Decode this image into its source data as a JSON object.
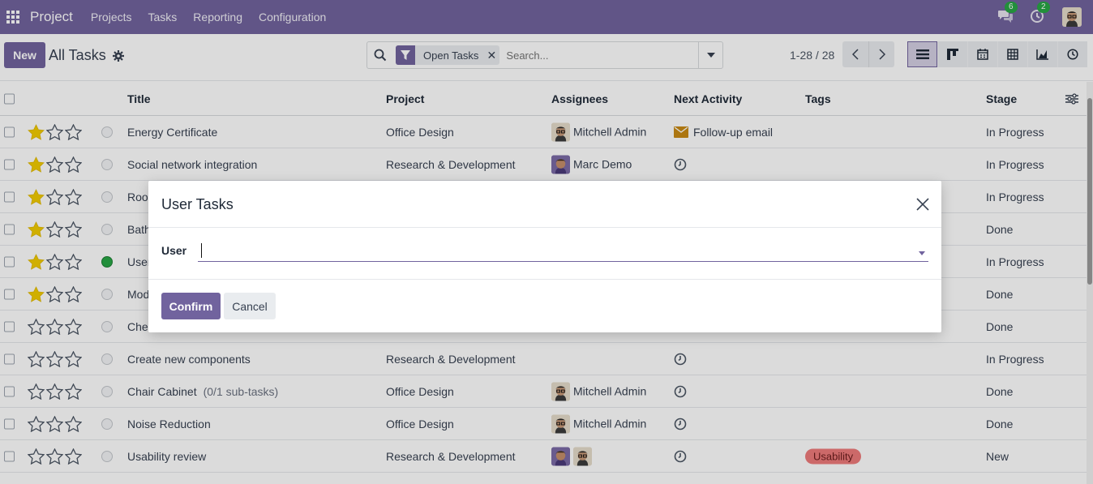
{
  "navbar": {
    "brand": "Project",
    "menu": [
      "Projects",
      "Tasks",
      "Reporting",
      "Configuration"
    ],
    "messages_count": "6",
    "activities_count": "2",
    "bg_color": "#71639e"
  },
  "control": {
    "new_label": "New",
    "breadcrumb": "All Tasks",
    "facet_label": "Open Tasks",
    "search_placeholder": "Search...",
    "pager": "1-28 / 28"
  },
  "columns": {
    "title": "Title",
    "project": "Project",
    "assignees": "Assignees",
    "next_activity": "Next Activity",
    "tags": "Tags",
    "stage": "Stage"
  },
  "rows": [
    {
      "stars": 1,
      "status": "normal",
      "title": "Energy Certificate",
      "sub": "",
      "project": "Office Design",
      "assignees": [
        "mitchell"
      ],
      "assignee_name": "Mitchell Admin",
      "activity": "mail",
      "activity_label": "Follow-up email",
      "tag": "",
      "stage": "In Progress"
    },
    {
      "stars": 1,
      "status": "normal",
      "title": "Social network integration",
      "sub": "",
      "project": "Research & Development",
      "assignees": [
        "marc"
      ],
      "assignee_name": "Marc Demo",
      "activity": "clock",
      "activity_label": "",
      "tag": "",
      "stage": "In Progress"
    },
    {
      "stars": 1,
      "status": "normal",
      "title": "Roo",
      "sub": "",
      "project": "",
      "assignees": [],
      "assignee_name": "",
      "activity": "",
      "activity_label": "",
      "tag": "",
      "stage": "In Progress"
    },
    {
      "stars": 1,
      "status": "normal",
      "title": "Bath",
      "sub": "",
      "project": "",
      "assignees": [],
      "assignee_name": "",
      "activity": "",
      "activity_label": "",
      "tag": "",
      "stage": "Done"
    },
    {
      "stars": 1,
      "status": "green",
      "title": "User",
      "sub": "",
      "project": "",
      "assignees": [],
      "assignee_name": "",
      "activity": "",
      "activity_label": "",
      "tag": "",
      "stage": "In Progress"
    },
    {
      "stars": 1,
      "status": "normal",
      "title": "Mod",
      "sub": "",
      "project": "",
      "assignees": [],
      "assignee_name": "",
      "activity": "",
      "activity_label": "",
      "tag": "",
      "stage": "Done"
    },
    {
      "stars": 0,
      "status": "normal",
      "title": "Che",
      "sub": "",
      "project": "",
      "assignees": [],
      "assignee_name": "",
      "activity": "",
      "activity_label": "",
      "tag": "",
      "stage": "Done"
    },
    {
      "stars": 0,
      "status": "normal",
      "title": "Create new components",
      "sub": "",
      "project": "Research & Development",
      "assignees": [],
      "assignee_name": "",
      "activity": "clock",
      "activity_label": "",
      "tag": "",
      "stage": "In Progress"
    },
    {
      "stars": 0,
      "status": "normal",
      "title": "Chair Cabinet",
      "sub": "(0/1 sub-tasks)",
      "project": "Office Design",
      "assignees": [
        "mitchell"
      ],
      "assignee_name": "Mitchell Admin",
      "activity": "clock",
      "activity_label": "",
      "tag": "",
      "stage": "Done"
    },
    {
      "stars": 0,
      "status": "normal",
      "title": "Noise Reduction",
      "sub": "",
      "project": "Office Design",
      "assignees": [
        "mitchell"
      ],
      "assignee_name": "Mitchell Admin",
      "activity": "clock",
      "activity_label": "",
      "tag": "",
      "stage": "Done"
    },
    {
      "stars": 0,
      "status": "normal",
      "title": "Usability review",
      "sub": "",
      "project": "Research & Development",
      "assignees": [
        "marc",
        "mitchell"
      ],
      "assignee_name": "",
      "activity": "clock",
      "activity_label": "",
      "tag": "Usability",
      "stage": "New"
    }
  ],
  "dialog": {
    "title": "User Tasks",
    "field_label": "User",
    "field_value": "",
    "confirm_label": "Confirm",
    "cancel_label": "Cancel"
  }
}
